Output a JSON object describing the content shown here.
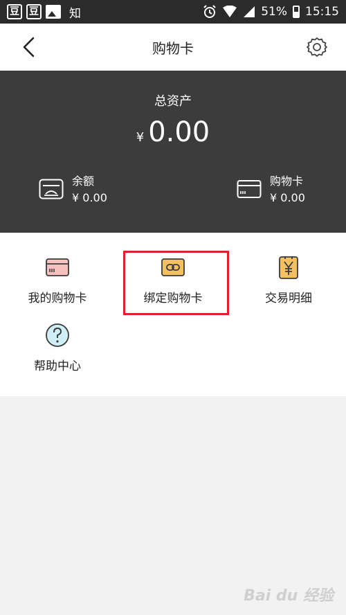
{
  "status_bar": {
    "app_icon_1": "豆",
    "app_icon_2": "豆",
    "app_icon_3": "知",
    "battery": "51%",
    "time": "15:15"
  },
  "header": {
    "title": "购物卡"
  },
  "assets": {
    "total_label": "总资产",
    "currency": "¥",
    "total_value": "0.00",
    "balance": {
      "label": "余额",
      "value": "¥ 0.00"
    },
    "shopping_card": {
      "label": "购物卡",
      "value": "¥ 0.00"
    }
  },
  "grid": {
    "my_cards": "我的购物卡",
    "bind_card": "绑定购物卡",
    "transactions": "交易明细",
    "help": "帮助中心"
  },
  "watermark": "Bai du 经验",
  "colors": {
    "panel": "#3c3c3c",
    "highlight": "#e0202a",
    "icon_yellow": "#f5c062",
    "icon_pink": "#f7c1bf",
    "icon_cyan": "#cfeef5"
  }
}
